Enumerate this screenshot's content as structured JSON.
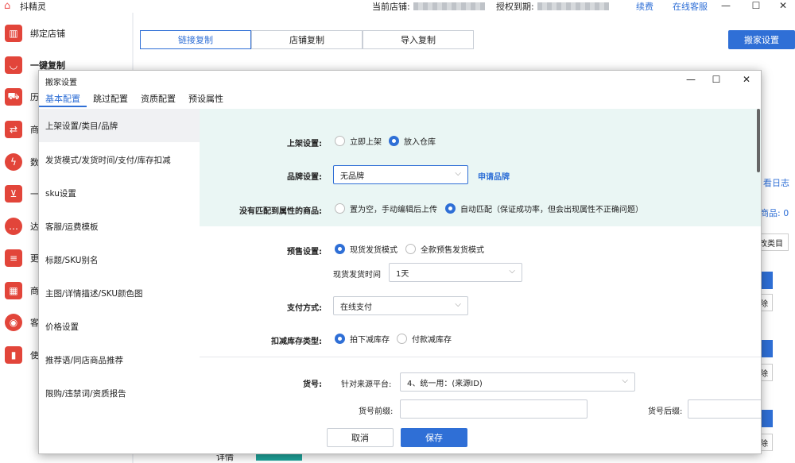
{
  "app": {
    "title": "抖精灵"
  },
  "top": {
    "current_shop_label": "当前店铺:",
    "auth_label": "授权到期:",
    "renew": "续费",
    "service": "在线客服"
  },
  "sidebar": {
    "items": [
      {
        "label": "绑定店铺",
        "icon": "shop-icon"
      },
      {
        "label": "一键复制",
        "icon": "bag-icon"
      },
      {
        "label": "历",
        "icon": "truck-icon"
      },
      {
        "label": "商",
        "icon": "swap-icon"
      },
      {
        "label": "数",
        "icon": "bolt-icon"
      },
      {
        "label": "一",
        "icon": "cart-icon"
      },
      {
        "label": "达",
        "icon": "chat-icon"
      },
      {
        "label": "更",
        "icon": "list-icon"
      },
      {
        "label": "商",
        "icon": "grid-icon"
      },
      {
        "label": "客",
        "icon": "headset-icon"
      },
      {
        "label": "使",
        "icon": "book-icon"
      }
    ]
  },
  "main": {
    "tabs": [
      "链接复制",
      "店铺复制",
      "导入复制"
    ],
    "move_button": "搬家设置",
    "log_link": "看日志",
    "goods_count": "商品: 0",
    "category_btn": "改类目",
    "row_btn": "除",
    "bottom_text": "详情"
  },
  "dialog": {
    "title": "搬家设置",
    "tabs": [
      "基本配置",
      "跳过配置",
      "资质配置",
      "预设属性"
    ],
    "left_items": [
      "上架设置/类目/品牌",
      "发货模式/发货时间/支付/库存扣减",
      "sku设置",
      "客服/运费模板",
      "标题/SKU别名",
      "主图/详情描述/SKU颜色图",
      "价格设置",
      "推荐语/同店商品推荐",
      "限购/违禁词/资质报告"
    ],
    "listing": {
      "label": "上架设置:",
      "opt1": "立即上架",
      "opt2": "放入仓库"
    },
    "brand": {
      "label": "品牌设置:",
      "value": "无品牌",
      "apply": "申请品牌"
    },
    "unmatched": {
      "label": "没有匹配到属性的商品:",
      "opt1": "置为空，手动编辑后上传",
      "opt2": "自动匹配（保证成功率，但会出现属性不正确问题）"
    },
    "presale": {
      "label": "预售设置:",
      "opt1": "现货发货模式",
      "opt2": "全款预售发货模式",
      "ship_time_label": "现货发货时间",
      "ship_time_value": "1天"
    },
    "payment": {
      "label": "支付方式:",
      "value": "在线支付"
    },
    "stock": {
      "label": "扣减库存类型:",
      "opt1": "拍下减库存",
      "opt2": "付款减库存"
    },
    "sku_no": {
      "label": "货号:",
      "platform_label": "针对来源平台:",
      "platform_value": "4、统一用：(来源ID)",
      "prefix_label": "货号前缀:",
      "suffix_label": "货号后缀:"
    },
    "cancel": "取消",
    "save": "保存"
  }
}
